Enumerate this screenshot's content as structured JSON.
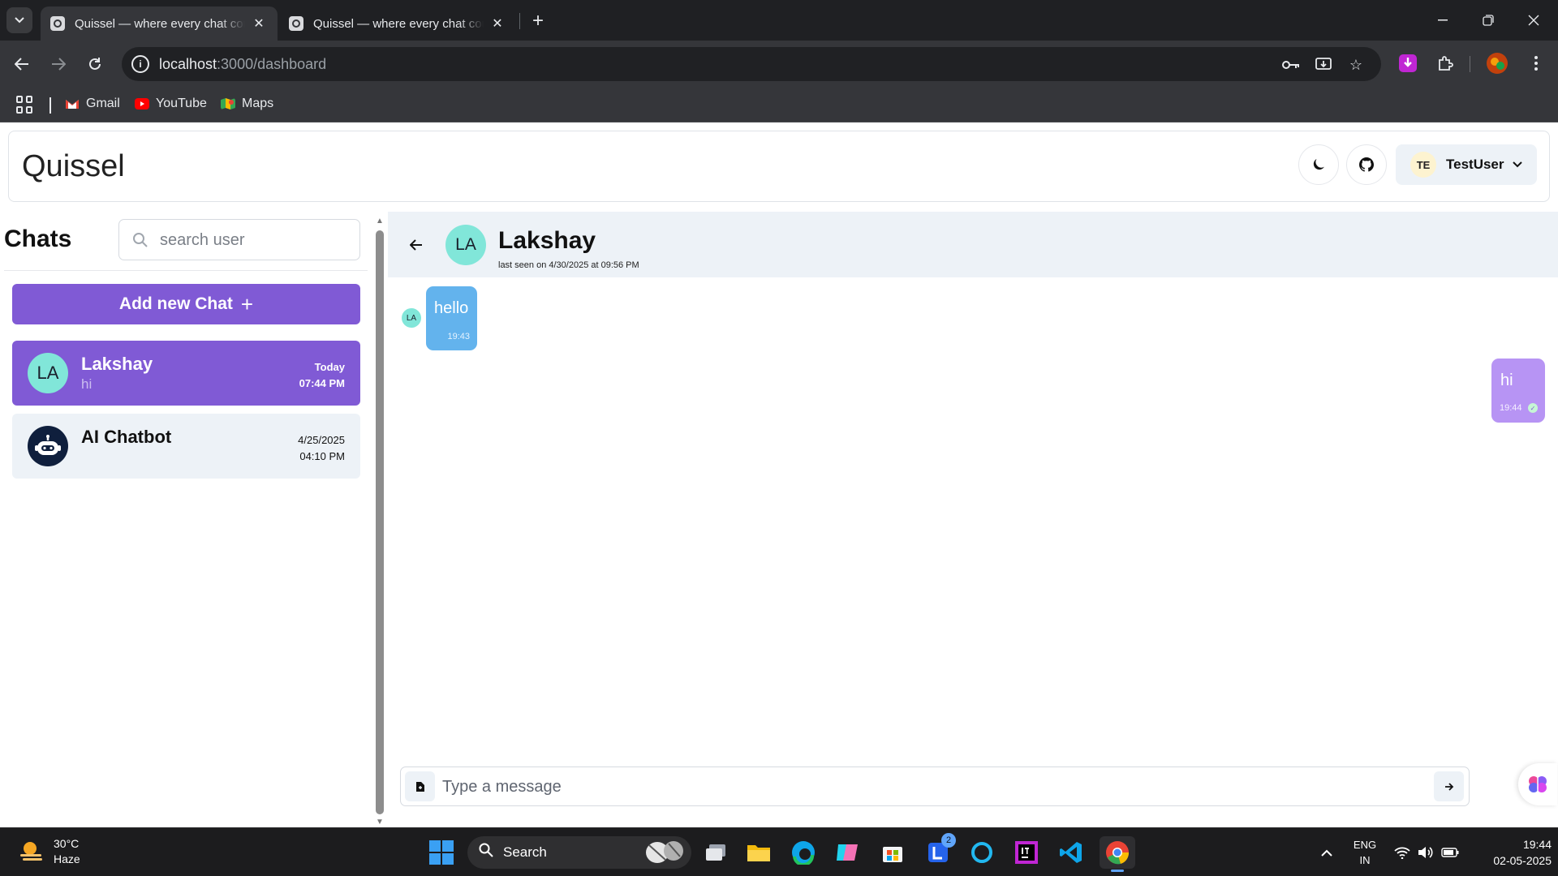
{
  "browser": {
    "tabs": [
      {
        "title": "Quissel — where every chat counts"
      },
      {
        "title": "Quissel — where every chat counts"
      }
    ],
    "url_host": "localhost",
    "url_path": ":3000/dashboard",
    "bookmarks": [
      {
        "label": "Gmail",
        "icon": "gmail-icon"
      },
      {
        "label": "YouTube",
        "icon": "youtube-icon"
      },
      {
        "label": "Maps",
        "icon": "maps-icon"
      }
    ]
  },
  "app": {
    "brand": "Quissel",
    "user": {
      "initials": "TE",
      "name": "TestUser"
    }
  },
  "sidebar": {
    "heading": "Chats",
    "search_placeholder": "search user",
    "add_chat_label": "Add new Chat",
    "chats": [
      {
        "initials": "LA",
        "name": "Lakshay",
        "last_message": "hi",
        "date": "Today",
        "time": "07:44 PM",
        "active": true
      },
      {
        "initials": "",
        "name": "AI Chatbot",
        "last_message": "",
        "date": "4/25/2025",
        "time": "04:10 PM",
        "active": false
      }
    ]
  },
  "conversation": {
    "peer_initials": "LA",
    "peer_name": "Lakshay",
    "last_seen": "last seen on 4/30/2025 at 09:56 PM",
    "messages": [
      {
        "direction": "incoming",
        "sender_initials": "LA",
        "text": "hello",
        "time": "19:43"
      },
      {
        "direction": "outgoing",
        "text": "hi",
        "time": "19:44",
        "read": true
      }
    ],
    "composer_placeholder": "Type a message"
  },
  "taskbar": {
    "weather_temp": "30°C",
    "weather_desc": "Haze",
    "search_label": "Search",
    "notification_badge": "2",
    "lang_line1": "ENG",
    "lang_line2": "IN",
    "time": "19:44",
    "date": "02-05-2025"
  },
  "colors": {
    "accent": "#805ad5",
    "incoming_bubble": "#63b3ed",
    "outgoing_bubble": "#b794f4",
    "avatar": "#81e6d9",
    "panel_bg": "#edf2f7"
  }
}
